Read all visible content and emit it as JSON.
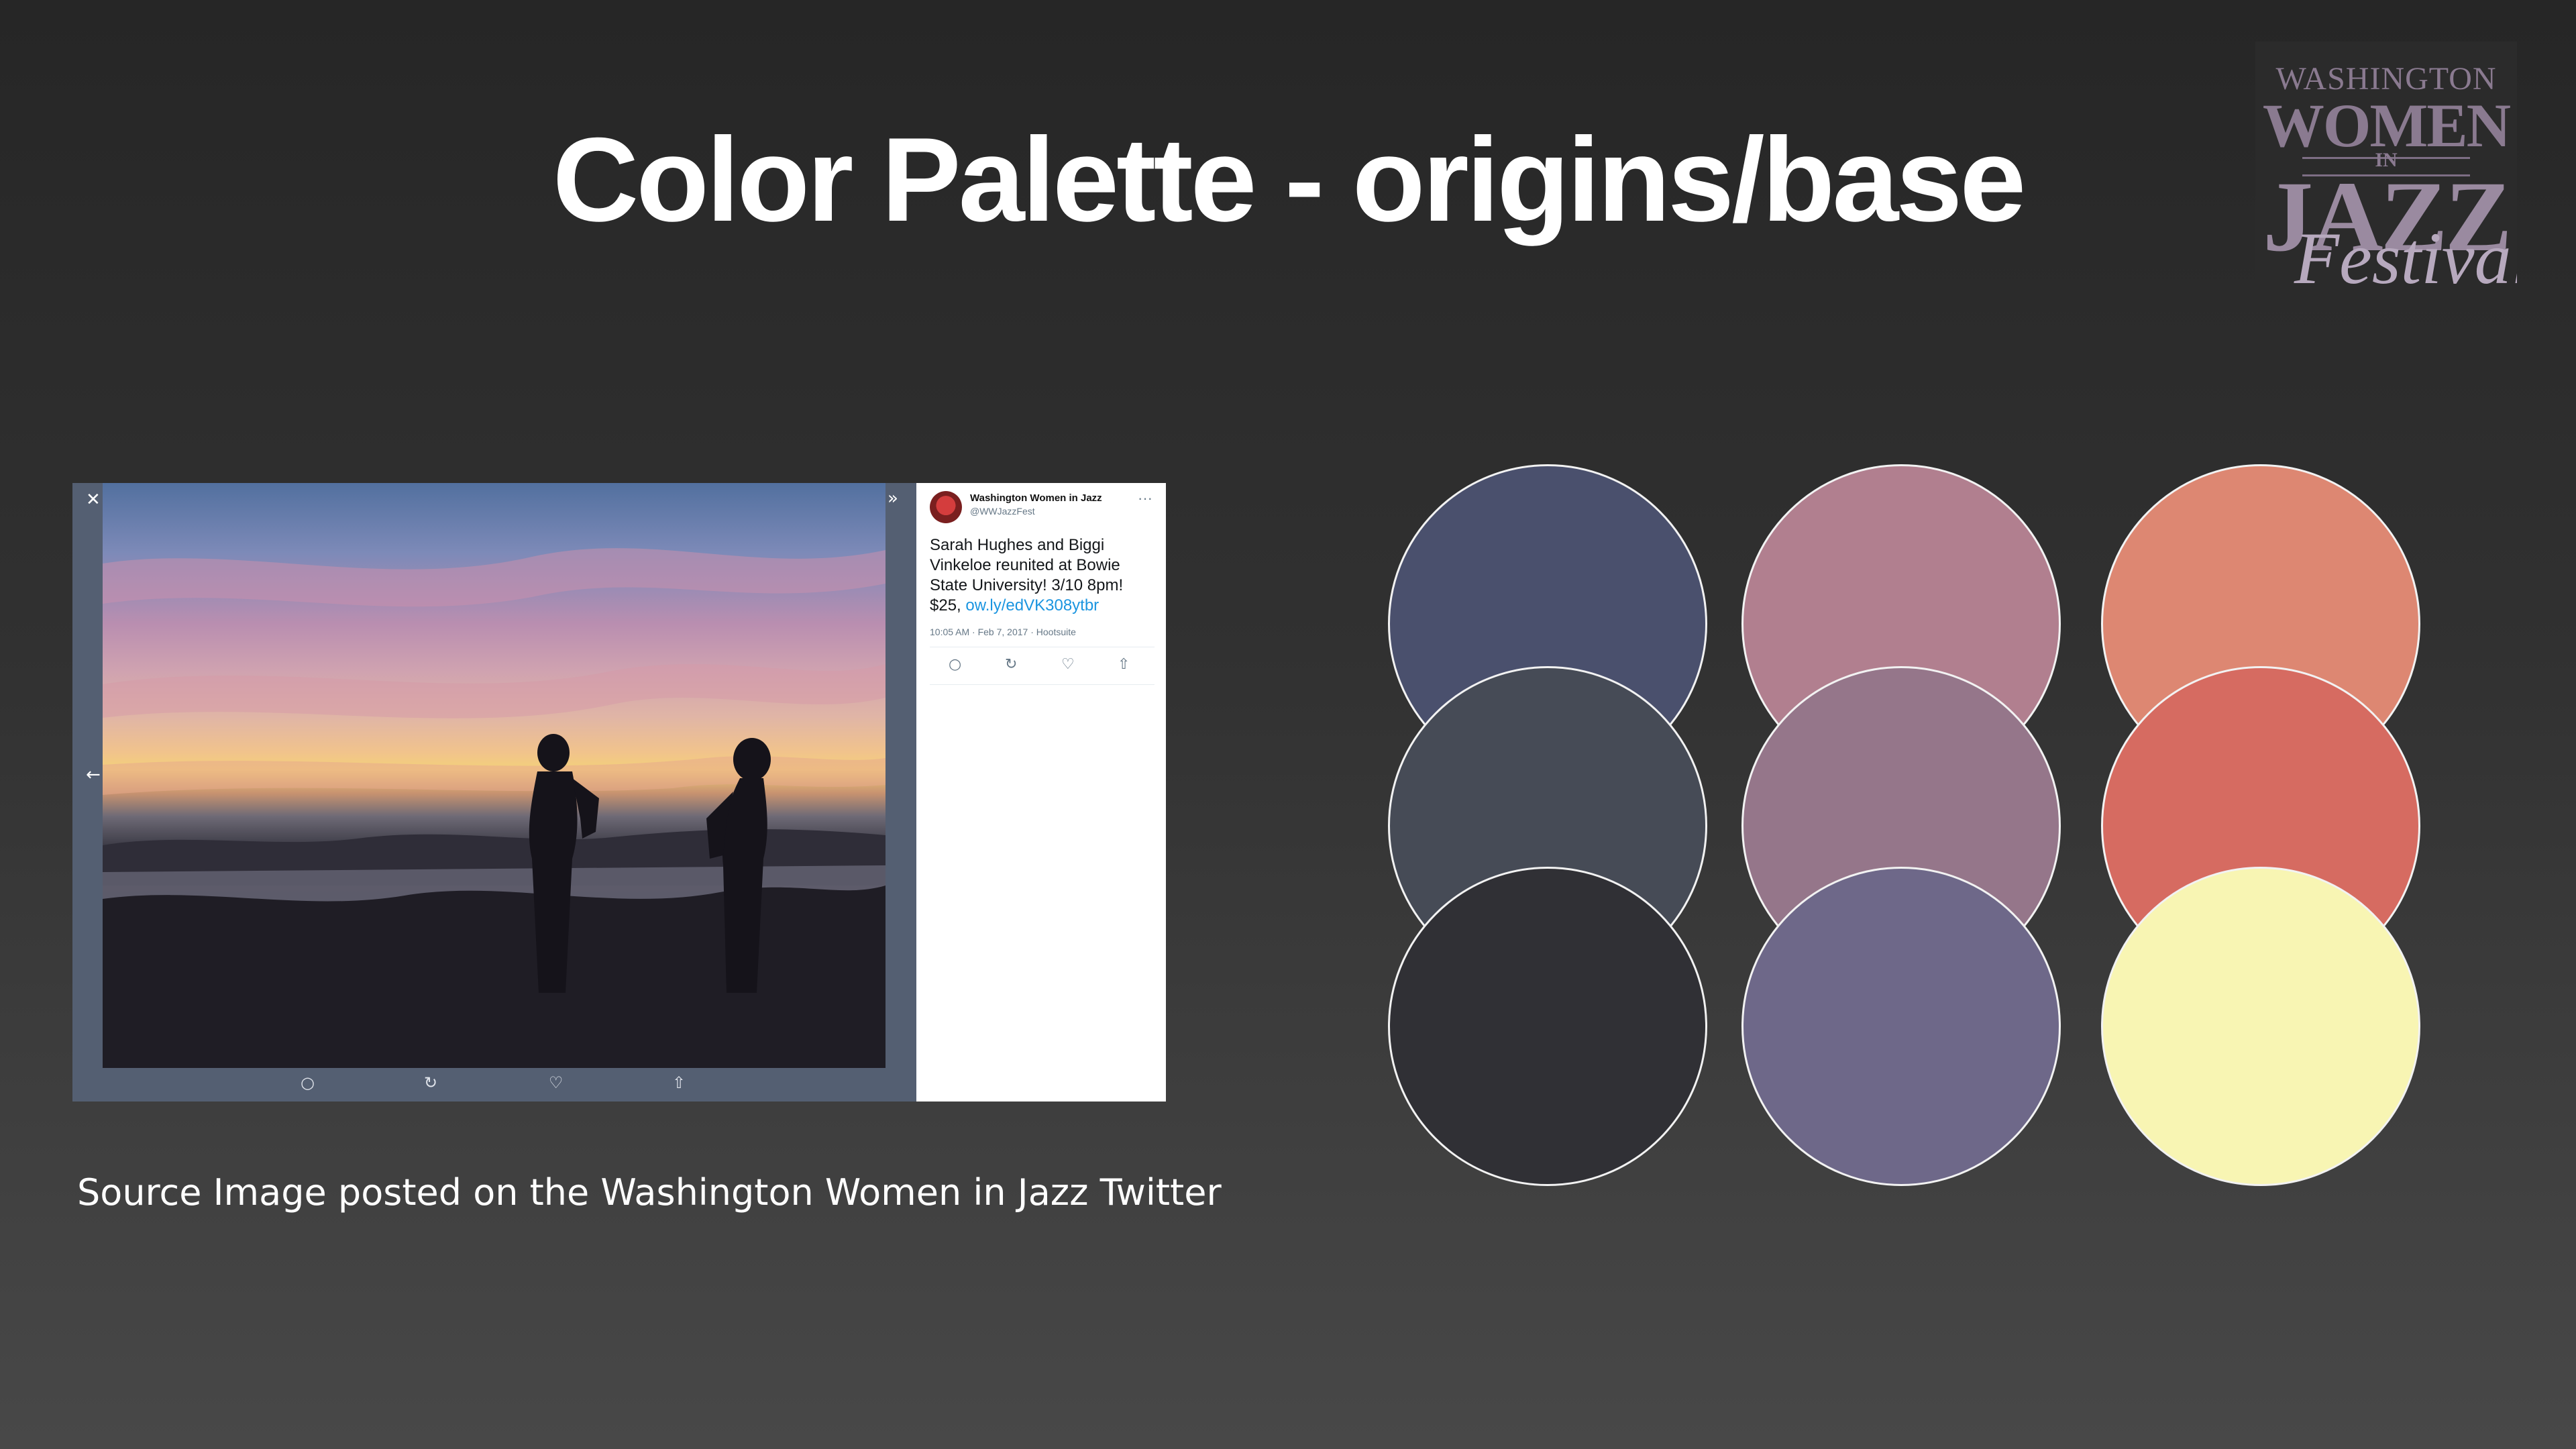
{
  "slide": {
    "title": "Color Palette - origins/base"
  },
  "logo": {
    "line1": "WASHINGTON",
    "line2": "WOMEN",
    "line3": "IN",
    "line4": "JAZZ",
    "line5": "Festival"
  },
  "tweet": {
    "name": "Washington Women in Jazz",
    "handle": "@WWJazzFest",
    "text": "Sarah Hughes and Biggi Vinkeloe reunited at Bowie State University! 3/10 8pm! $25,",
    "link": "ow.ly/edVK308ytbr",
    "meta": "10:05 AM · Feb 7, 2017 · Hootsuite",
    "more_icon": "···",
    "actions": {
      "reply": "○",
      "retweet": "↻",
      "like": "♡",
      "share": "⇧"
    }
  },
  "photo_controls": {
    "close": "✕",
    "expand": "»",
    "prev": "←"
  },
  "caption": "Source Image posted on the Washington Women in Jazz Twitter",
  "palette": {
    "colors": [
      [
        "#4a506d",
        "#b17f8f",
        "#dd8772"
      ],
      [
        "#464b56",
        "#95768a",
        "#d66b61"
      ],
      [
        "#303035",
        "#6e6889",
        "#f8f5b3"
      ]
    ]
  }
}
